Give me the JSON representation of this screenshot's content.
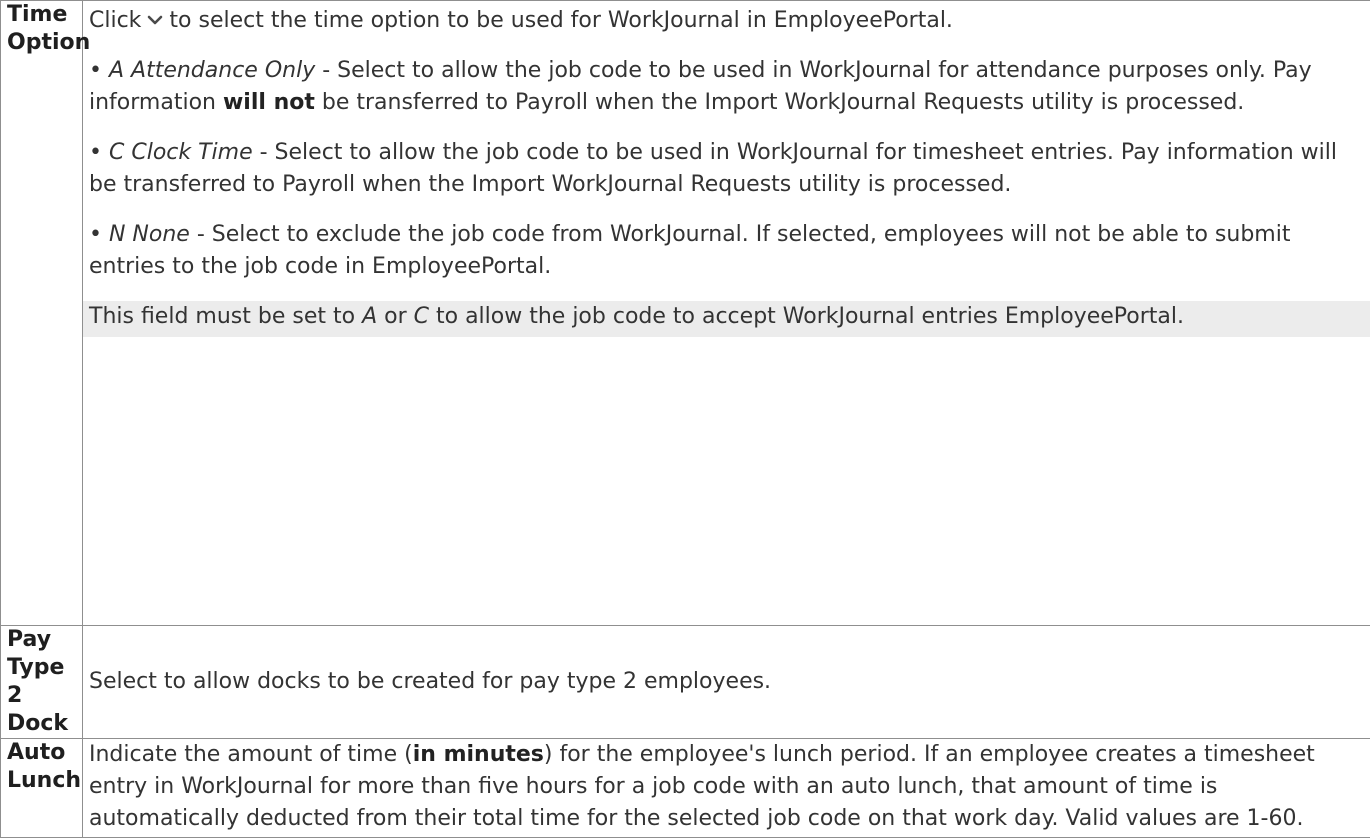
{
  "rows": [
    {
      "term": "Time Option",
      "intro_before": "Click",
      "intro_icon": "chevron-down-icon",
      "intro_after": "to select the time option to be used for WorkJournal in EmployeePortal.",
      "options": [
        {
          "bullet": "•",
          "code": "A Attendance Only",
          "text_before": " - Select to allow the job code to be used in WorkJournal for attendance purposes only. Pay information ",
          "bold": "will not",
          "text_after": " be transferred to Payroll when the Import WorkJournal Requests utility is processed."
        },
        {
          "bullet": "•",
          "code": "C Clock Time",
          "text": " - Select to allow the job code to be used in WorkJournal for timesheet entries. Pay information will be transferred to Payroll when the Import WorkJournal Requests utility is processed."
        },
        {
          "bullet": "•",
          "code": "N None",
          "text": " - Select to exclude the job code from WorkJournal. If selected, employees will not be able to submit entries to the job code in EmployeePortal."
        }
      ],
      "note": {
        "before": "This field must be set to ",
        "opt1": "A",
        "mid": " or ",
        "opt2": "C",
        "after": " to allow the job code to accept WorkJournal entries EmployeePortal."
      }
    },
    {
      "term": "Pay Type 2 Dock",
      "definition": "Select to allow docks to be created for pay type 2 employees."
    },
    {
      "term": "Auto Lunch",
      "def_before": "Indicate the amount of time (",
      "def_bold": "in minutes",
      "def_after": ") for the employee's lunch period. If an employee creates a timesheet entry in WorkJournal for more than five hours for a job code with an auto lunch, that amount of time is automatically deducted from their total time for the selected job code on that work day. Valid values are 1-60."
    }
  ],
  "colors": {
    "border": "#8f8f8f",
    "note_background": "#ececec",
    "text": "#333333"
  }
}
